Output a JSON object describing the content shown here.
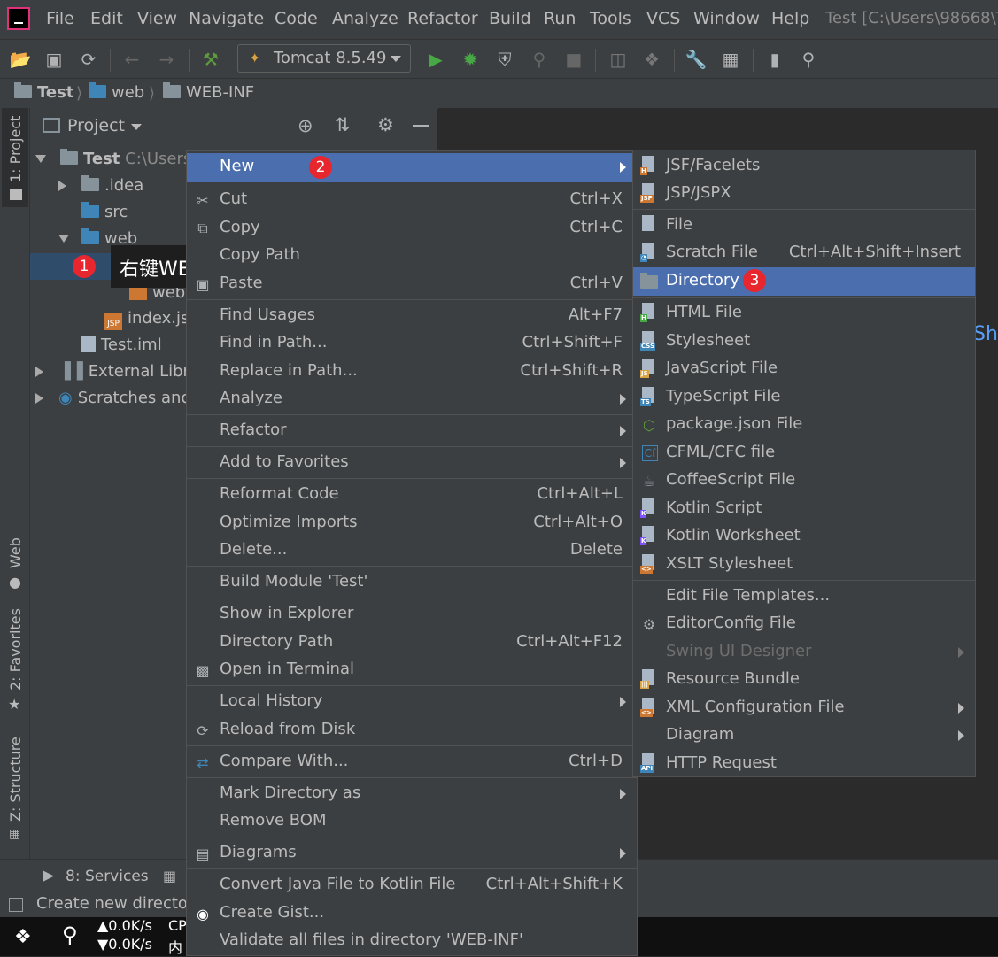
{
  "menubar": {
    "items": [
      "File",
      "Edit",
      "View",
      "Navigate",
      "Code",
      "Analyze",
      "Refactor",
      "Build",
      "Run",
      "Tools",
      "VCS",
      "Window",
      "Help"
    ],
    "window_title": "Test [C:\\Users\\98668\\T"
  },
  "toolbar": {
    "run_config": "Tomcat 8.5.49"
  },
  "breadcrumb": {
    "items": [
      "Test",
      "web",
      "WEB-INF"
    ]
  },
  "left_strip": {
    "tabs": [
      "1: Project",
      "Web",
      "2: Favorites",
      "Z: Structure"
    ]
  },
  "project_panel": {
    "title": "Project",
    "tree": [
      {
        "label": "Test",
        "extra": "C:\\Users\\"
      },
      {
        "label": ".idea"
      },
      {
        "label": "src"
      },
      {
        "label": "web"
      },
      {
        "label": "web"
      },
      {
        "label": "index.js"
      },
      {
        "label": "Test.iml"
      },
      {
        "label": "External Libra"
      },
      {
        "label": "Scratches and"
      }
    ]
  },
  "callout": {
    "text": "右键WEB-INF文件夹",
    "badge1": "1",
    "badge2": "2",
    "badge3": "3"
  },
  "context_menu": {
    "items": [
      {
        "label": "New",
        "shortcut": ""
      },
      {
        "label": "Cut",
        "shortcut": "Ctrl+X"
      },
      {
        "label": "Copy",
        "shortcut": "Ctrl+C"
      },
      {
        "label": "Copy Path",
        "shortcut": ""
      },
      {
        "label": "Paste",
        "shortcut": "Ctrl+V"
      },
      {
        "label": "Find Usages",
        "shortcut": "Alt+F7"
      },
      {
        "label": "Find in Path...",
        "shortcut": "Ctrl+Shift+F"
      },
      {
        "label": "Replace in Path...",
        "shortcut": "Ctrl+Shift+R"
      },
      {
        "label": "Analyze",
        "shortcut": ""
      },
      {
        "label": "Refactor",
        "shortcut": ""
      },
      {
        "label": "Add to Favorites",
        "shortcut": ""
      },
      {
        "label": "Reformat Code",
        "shortcut": "Ctrl+Alt+L"
      },
      {
        "label": "Optimize Imports",
        "shortcut": "Ctrl+Alt+O"
      },
      {
        "label": "Delete...",
        "shortcut": "Delete"
      },
      {
        "label": "Build Module 'Test'",
        "shortcut": ""
      },
      {
        "label": "Show in Explorer",
        "shortcut": ""
      },
      {
        "label": "Directory Path",
        "shortcut": "Ctrl+Alt+F12"
      },
      {
        "label": "Open in Terminal",
        "shortcut": ""
      },
      {
        "label": "Local History",
        "shortcut": ""
      },
      {
        "label": "Reload from Disk",
        "shortcut": ""
      },
      {
        "label": "Compare With...",
        "shortcut": "Ctrl+D"
      },
      {
        "label": "Mark Directory as",
        "shortcut": ""
      },
      {
        "label": "Remove BOM",
        "shortcut": ""
      },
      {
        "label": "Diagrams",
        "shortcut": ""
      },
      {
        "label": "Convert Java File to Kotlin File",
        "shortcut": "Ctrl+Alt+Shift+K"
      },
      {
        "label": "Create Gist...",
        "shortcut": ""
      },
      {
        "label": "Validate all files in directory 'WEB-INF'",
        "shortcut": ""
      }
    ]
  },
  "submenu": {
    "items": [
      {
        "label": "JSF/Facelets",
        "shortcut": ""
      },
      {
        "label": "JSP/JSPX",
        "shortcut": ""
      },
      {
        "label": "File",
        "shortcut": ""
      },
      {
        "label": "Scratch File",
        "shortcut": "Ctrl+Alt+Shift+Insert"
      },
      {
        "label": "Directory",
        "shortcut": ""
      },
      {
        "label": "HTML File",
        "shortcut": ""
      },
      {
        "label": "Stylesheet",
        "shortcut": ""
      },
      {
        "label": "JavaScript File",
        "shortcut": ""
      },
      {
        "label": "TypeScript File",
        "shortcut": ""
      },
      {
        "label": "package.json File",
        "shortcut": ""
      },
      {
        "label": "CFML/CFC file",
        "shortcut": ""
      },
      {
        "label": "CoffeeScript File",
        "shortcut": ""
      },
      {
        "label": "Kotlin Script",
        "shortcut": ""
      },
      {
        "label": "Kotlin Worksheet",
        "shortcut": ""
      },
      {
        "label": "XSLT Stylesheet",
        "shortcut": ""
      },
      {
        "label": "Edit File Templates...",
        "shortcut": ""
      },
      {
        "label": "EditorConfig File",
        "shortcut": ""
      },
      {
        "label": "Swing UI Designer",
        "shortcut": ""
      },
      {
        "label": "Resource Bundle",
        "shortcut": ""
      },
      {
        "label": "XML Configuration File",
        "shortcut": ""
      },
      {
        "label": "Diagram",
        "shortcut": ""
      },
      {
        "label": "HTTP Request",
        "shortcut": ""
      }
    ]
  },
  "editor": {
    "partial_text": "Sh"
  },
  "bottom": {
    "services": "8: Services",
    "status": "Create new director"
  },
  "taskbar": {
    "net_up": "▲0.0K/s",
    "net_down": "▼0.0K/s",
    "cpu": "CP",
    "mem": "内"
  },
  "colors": {
    "selection": "#4b6eaf",
    "badge": "#e8262e",
    "panel": "#3c3f41",
    "editor": "#2b2b2b"
  }
}
